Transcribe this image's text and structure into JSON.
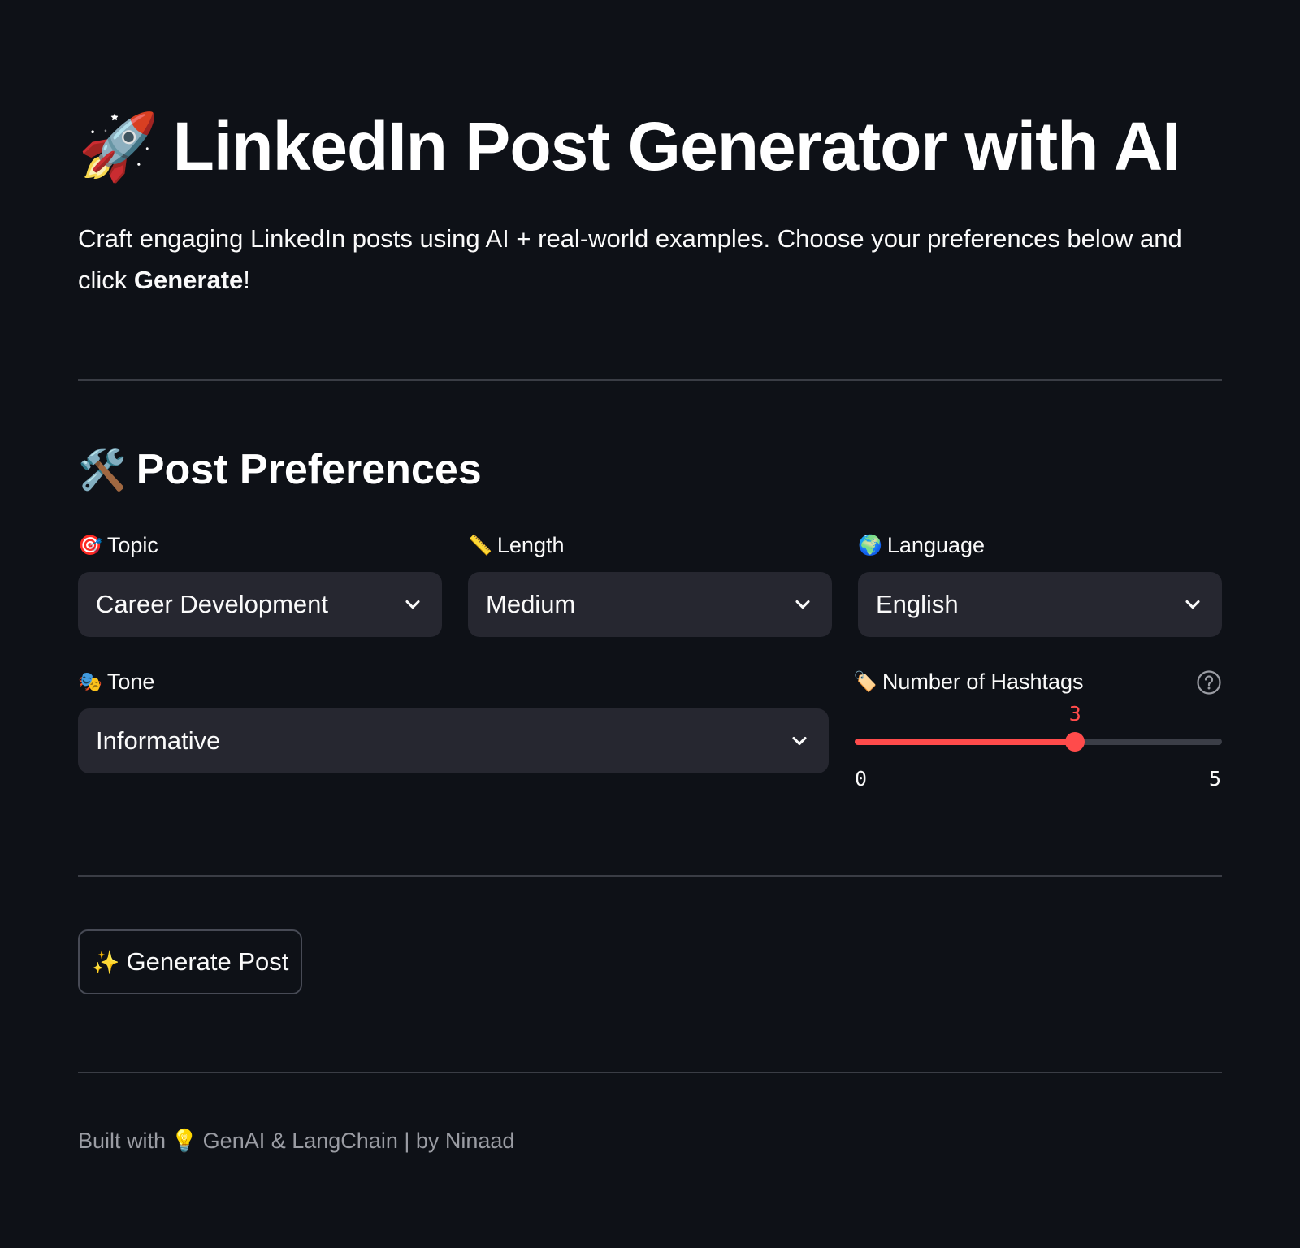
{
  "header": {
    "title_emoji": "🚀",
    "title": "LinkedIn Post Generator with AI",
    "intro_text": "Craft engaging LinkedIn posts using AI + real-world examples. Choose your preferences below and click ",
    "intro_bold": "Generate",
    "intro_suffix": "!"
  },
  "preferences": {
    "section_emoji": "🛠️",
    "section_title": "Post Preferences",
    "topic": {
      "emoji": "🎯",
      "label": "Topic",
      "value": "Career Development"
    },
    "length": {
      "emoji": "📏",
      "label": "Length",
      "value": "Medium"
    },
    "language": {
      "emoji": "🌍",
      "label": "Language",
      "value": "English"
    },
    "tone": {
      "emoji": "🎭",
      "label": "Tone",
      "value": "Informative"
    },
    "hashtags": {
      "emoji": "🏷️",
      "label": "Number of Hashtags",
      "value": "3",
      "min": "0",
      "max": "5",
      "fraction": 0.6
    }
  },
  "actions": {
    "generate_emoji": "✨",
    "generate_label": "Generate Post"
  },
  "footer": {
    "prefix": "Built with",
    "emoji": "💡",
    "suffix": "GenAI & LangChain | by Ninaad"
  },
  "colors": {
    "background": "#0e1117",
    "input_bg": "#262730",
    "accent": "#ff4b4b",
    "muted_text": "#9a9ca3"
  }
}
